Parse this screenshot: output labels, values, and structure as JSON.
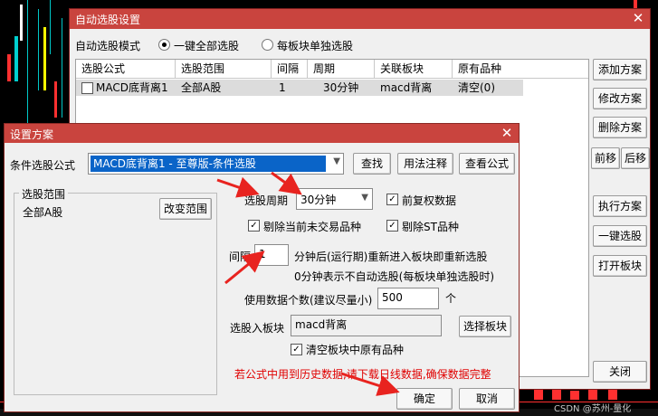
{
  "main_dialog": {
    "title": "自动选股设置",
    "close_glyph": "✕",
    "mode_label": "自动选股模式",
    "mode_options": [
      {
        "label": "一键全部选股",
        "selected": true
      },
      {
        "label": "每板块单独选股",
        "selected": false
      }
    ],
    "table": {
      "columns": [
        "选股公式",
        "选股范围",
        "间隔",
        "周期",
        "关联板块",
        "原有品种"
      ],
      "rows": [
        {
          "formula": "MACD底背离1",
          "range": "全部A股",
          "interval": "1",
          "period": "30分钟",
          "sector": "macd背离",
          "original": "清空(0)"
        }
      ]
    },
    "side_buttons": {
      "add": "添加方案",
      "modify": "修改方案",
      "delete": "删除方案",
      "move_up": "前移",
      "move_down": "后移",
      "execute": "执行方案",
      "one_key": "一键选股",
      "open_sector": "打开板块",
      "close": "关闭"
    }
  },
  "settings_dialog": {
    "title": "设置方案",
    "close_glyph": "✕",
    "formula_label": "条件选股公式",
    "formula_value": "MACD底背离1  -  至尊版-条件选股",
    "find_button": "查找",
    "usage_button": "用法注释",
    "view_button": "查看公式",
    "range_group_label": "选股范围",
    "range_value": "全部A股",
    "change_range_button": "改变范围",
    "period_label": "选股周期",
    "period_value": "30分钟",
    "checkbox_adjust": {
      "label": "前复权数据",
      "checked": true
    },
    "checkbox_remove_untraded": {
      "label": "剔除当前未交易品种",
      "checked": true
    },
    "checkbox_remove_st": {
      "label": "剔除ST品种",
      "checked": true
    },
    "interval_label": "间隔",
    "interval_value": "1",
    "interval_desc1": "分钟后(运行期)重新进入板块即重新选股",
    "interval_desc2": "0分钟表示不自动选股(每板块单独选股时)",
    "data_count_label": "使用数据个数(建议尽量小)",
    "data_count_value": "500",
    "data_count_unit": "个",
    "target_sector_label": "选股入板块",
    "target_sector_value": "macd背离",
    "select_sector_button": "选择板块",
    "checkbox_clear": {
      "label": "清空板块中原有品种",
      "checked": true
    },
    "warning_text": "若公式中用到历史数据,请下载日线数据,确保数据完整",
    "ok_button": "确定",
    "cancel_button": "取消"
  },
  "watermark": "CSDN @苏州-量化",
  "colors": {
    "titlebar": "#c9443e",
    "selection": "#0a64c8",
    "warning": "#e00000",
    "annotation_arrow": "#e8231f"
  }
}
